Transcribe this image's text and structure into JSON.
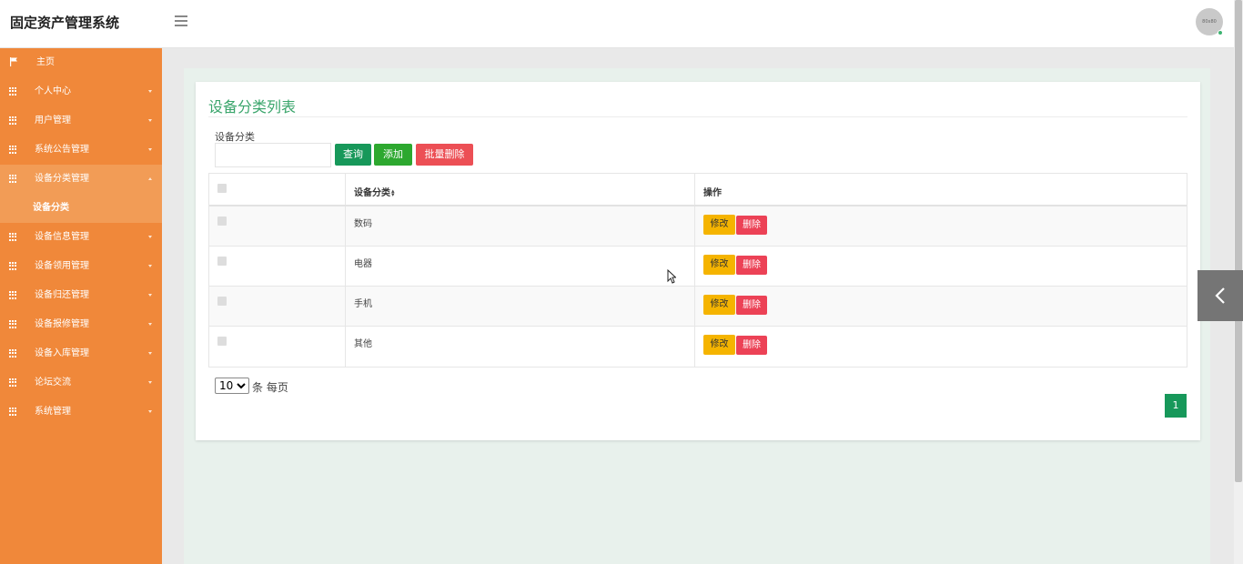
{
  "app": {
    "title": "固定资产管理系统"
  },
  "header": {
    "avatar_text": "80x80"
  },
  "sidebar": {
    "items": [
      {
        "label": "主页",
        "icon": "flag-icon"
      },
      {
        "label": "个人中心",
        "icon": "grid-icon"
      },
      {
        "label": "用户管理",
        "icon": "grid-icon"
      },
      {
        "label": "系统公告管理",
        "icon": "grid-icon"
      },
      {
        "label": "设备分类管理",
        "icon": "grid-icon",
        "expanded": true
      },
      {
        "label": "设备分类",
        "sub": true,
        "active": true
      },
      {
        "label": "设备信息管理",
        "icon": "grid-icon"
      },
      {
        "label": "设备领用管理",
        "icon": "grid-icon"
      },
      {
        "label": "设备归还管理",
        "icon": "grid-icon"
      },
      {
        "label": "设备报修管理",
        "icon": "grid-icon"
      },
      {
        "label": "设备入库管理",
        "icon": "grid-icon"
      },
      {
        "label": "论坛交流",
        "icon": "grid-icon"
      },
      {
        "label": "系统管理",
        "icon": "grid-icon"
      }
    ]
  },
  "main": {
    "title": "设备分类列表",
    "filter": {
      "label": "设备分类",
      "value": ""
    },
    "buttons": {
      "query": "查询",
      "add": "添加",
      "batch_delete": "批量删除"
    },
    "table": {
      "columns": [
        "",
        "设备分类",
        "操作"
      ],
      "sort_icon": "sort-icon",
      "rows": [
        {
          "category": "数码"
        },
        {
          "category": "电器"
        },
        {
          "category": "手机"
        },
        {
          "category": "其他"
        }
      ],
      "row_actions": {
        "edit": "修改",
        "delete": "删除"
      }
    },
    "pagination": {
      "page_size": "10",
      "page_size_options": [
        "10"
      ],
      "per_page_text": "条 每页",
      "current_page": "1"
    }
  },
  "colors": {
    "sidebar": "#f0883a",
    "sidebar_active": "#f29c56",
    "title_green": "#3aa56b",
    "query": "#17985a",
    "add": "#2da82f",
    "danger": "#ec4f55",
    "edit": "#f5b400"
  }
}
